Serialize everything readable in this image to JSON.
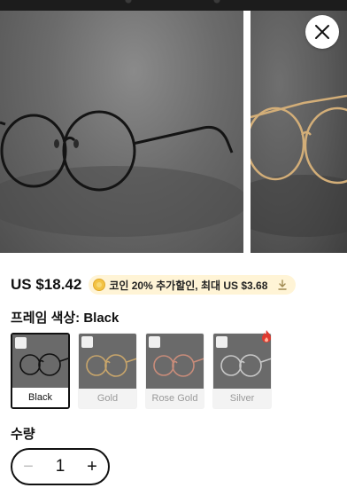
{
  "price": {
    "amount": "US $18.42"
  },
  "coin_promo": {
    "text": "코인 20% 추가할인, 최대 US $3.68",
    "icon": "coin-icon"
  },
  "color_option": {
    "label": "프레임 색상:",
    "selected": "Black"
  },
  "swatches": [
    {
      "name": "Black",
      "selected": true,
      "frame_color": "#1a1a1a"
    },
    {
      "name": "Gold",
      "selected": false,
      "frame_color": "#c9a66b"
    },
    {
      "name": "Rose Gold",
      "selected": false,
      "frame_color": "#c98c7a"
    },
    {
      "name": "Silver",
      "selected": false,
      "frame_color": "#c8c8c8"
    }
  ],
  "quantity": {
    "label": "수량",
    "value": "1",
    "minus": "−",
    "plus": "+"
  },
  "colors": {
    "accent": "#111111",
    "promo_bg": "#fff4d6",
    "hot": "#e03a2f"
  }
}
